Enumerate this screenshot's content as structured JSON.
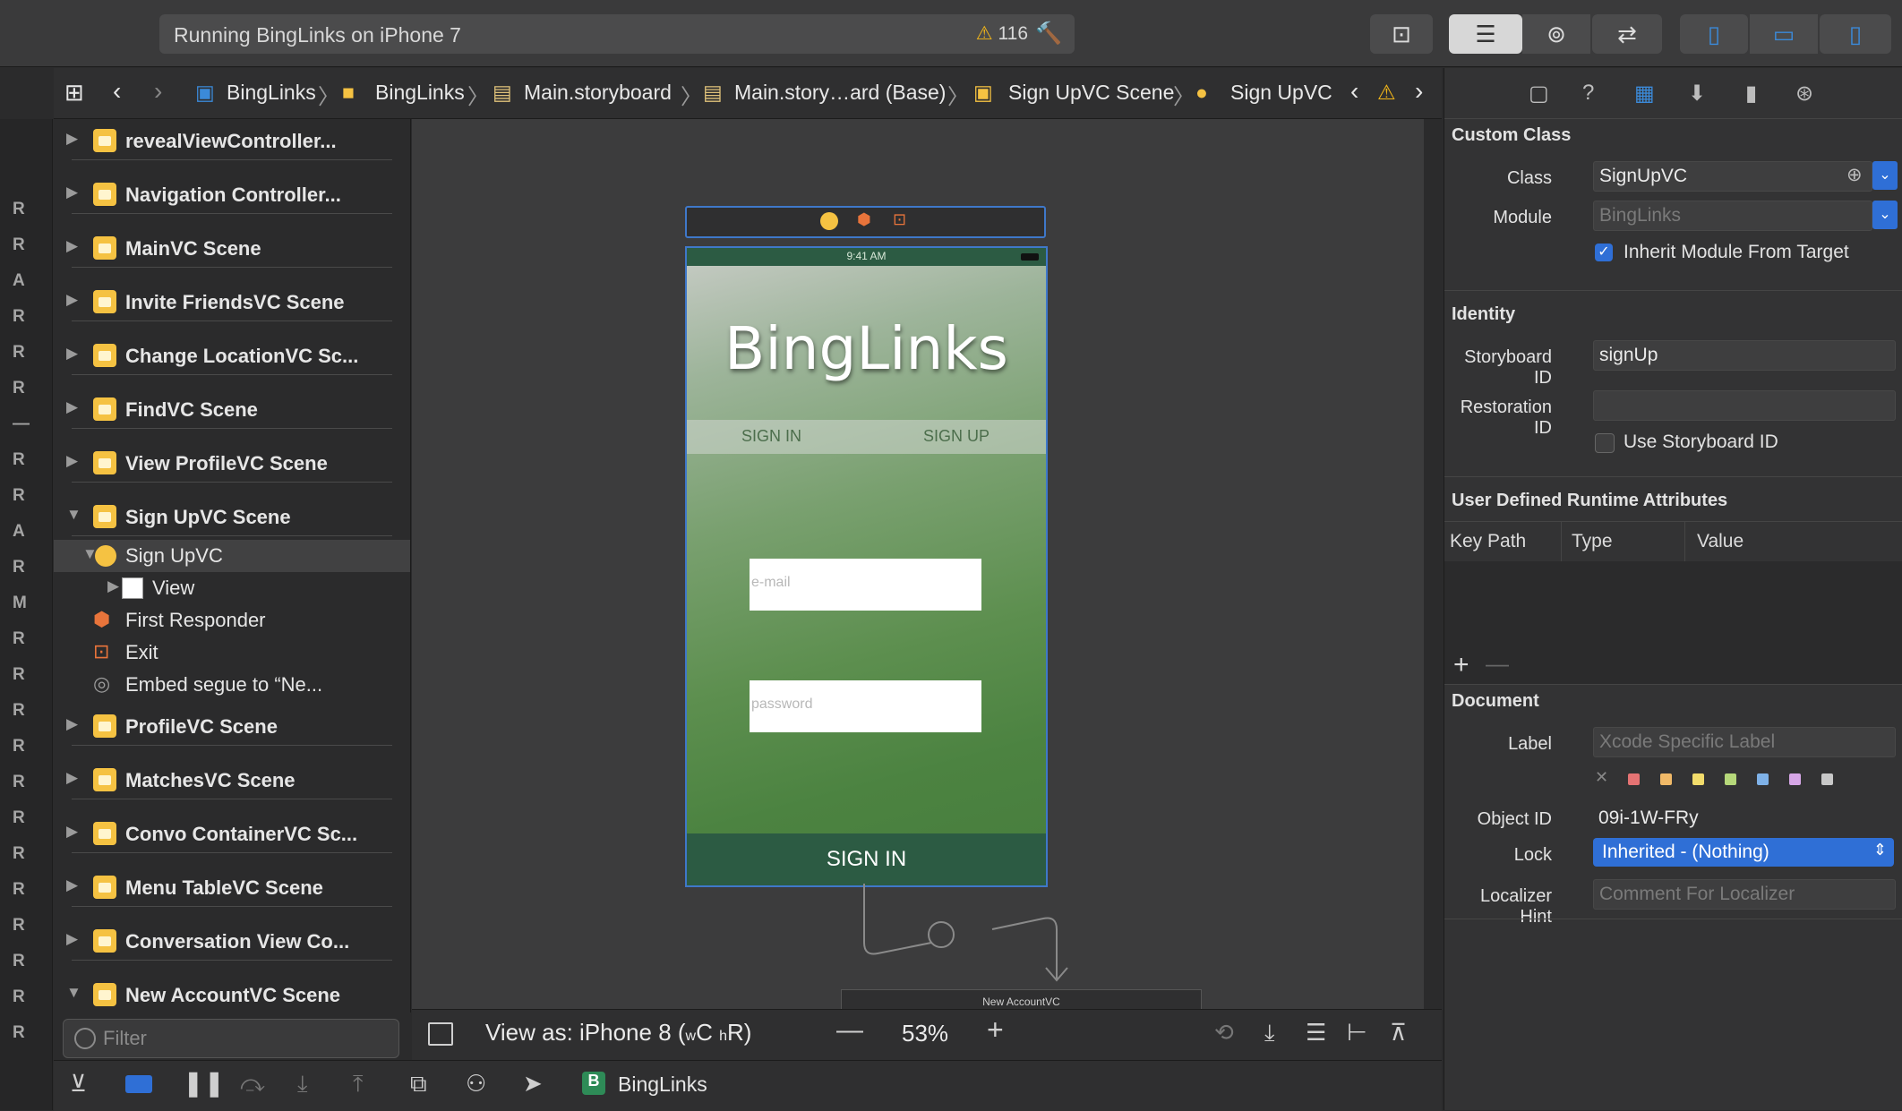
{
  "toolbar": {
    "status_title": "Running BingLinks on iPhone 7",
    "warning_count": "116"
  },
  "jumpbar": {
    "crumbs": [
      "BingLinks",
      "BingLinks",
      "Main.storyboard",
      "Main.story…ard (Base)",
      "Sign UpVC Scene",
      "Sign UpVC"
    ]
  },
  "gutter": [
    "R",
    "R",
    "A",
    "R",
    "R",
    "R",
    "—",
    "R",
    "R",
    "A",
    "R",
    "M",
    "R",
    "R",
    "R",
    "R",
    "R",
    "R",
    "R",
    "R",
    "R",
    "R",
    "R",
    "R"
  ],
  "outline": {
    "scenes_top": [
      "revealViewController...",
      "Navigation Controller...",
      "MainVC Scene",
      "Invite FriendsVC Scene",
      "Change LocationVC Sc...",
      "FindVC Scene",
      "View ProfileVC Scene",
      "Sign UpVC Scene"
    ],
    "children": [
      "Sign UpVC",
      "View",
      "First Responder",
      "Exit",
      "Embed segue to “Ne..."
    ],
    "scenes_bottom": [
      "ProfileVC Scene",
      "MatchesVC Scene",
      "Convo ContainerVC Sc...",
      "Menu TableVC Scene",
      "Conversation View Co...",
      "New AccountVC Scene"
    ],
    "filter_placeholder": "Filter"
  },
  "canvas": {
    "phone_time": "9:41 AM",
    "app_logo": "BingLinks",
    "tab_signin": "SIGN IN",
    "tab_signup": "SIGN UP",
    "email_placeholder": "e-mail",
    "password_placeholder": "password",
    "signin_button": "SIGN IN",
    "next_scene_title": "New AccountVC",
    "view_as": "View as: iPhone 8 (",
    "view_as_w": "w",
    "view_as_c": "C ",
    "view_as_h": "h",
    "view_as_r": "R)",
    "zoom": "53%"
  },
  "bottombar": {
    "scheme": "BingLinks"
  },
  "inspector": {
    "custom_class": {
      "header": "Custom Class",
      "class_label": "Class",
      "class_value": "SignUpVC",
      "module_label": "Module",
      "module_placeholder": "BingLinks",
      "inherit_label": "Inherit Module From Target",
      "inherit_checked": true
    },
    "identity": {
      "header": "Identity",
      "storyboard_id_label": "Storyboard ID",
      "storyboard_id_value": "signUp",
      "restoration_id_label": "Restoration ID",
      "use_storyboard_id_label": "Use Storyboard ID"
    },
    "runtime": {
      "header": "User Defined Runtime Attributes",
      "columns": [
        "Key Path",
        "Type",
        "Value"
      ]
    },
    "document": {
      "header": "Document",
      "label_label": "Label",
      "label_placeholder": "Xcode Specific Label",
      "swatches": [
        "#e57373",
        "#f0b968",
        "#f2dc6b",
        "#b6d87a",
        "#7fb2e8",
        "#d6a6e6",
        "#c8c8c8"
      ],
      "object_id_label": "Object ID",
      "object_id_value": "09i-1W-FRy",
      "lock_label": "Lock",
      "lock_value": "Inherited - (Nothing)",
      "localizer_label": "Localizer Hint",
      "localizer_placeholder": "Comment For Localizer"
    }
  },
  "colors": {
    "accent": "#2f6fd6",
    "warning": "#f2b619",
    "folder": "#f5c242"
  }
}
